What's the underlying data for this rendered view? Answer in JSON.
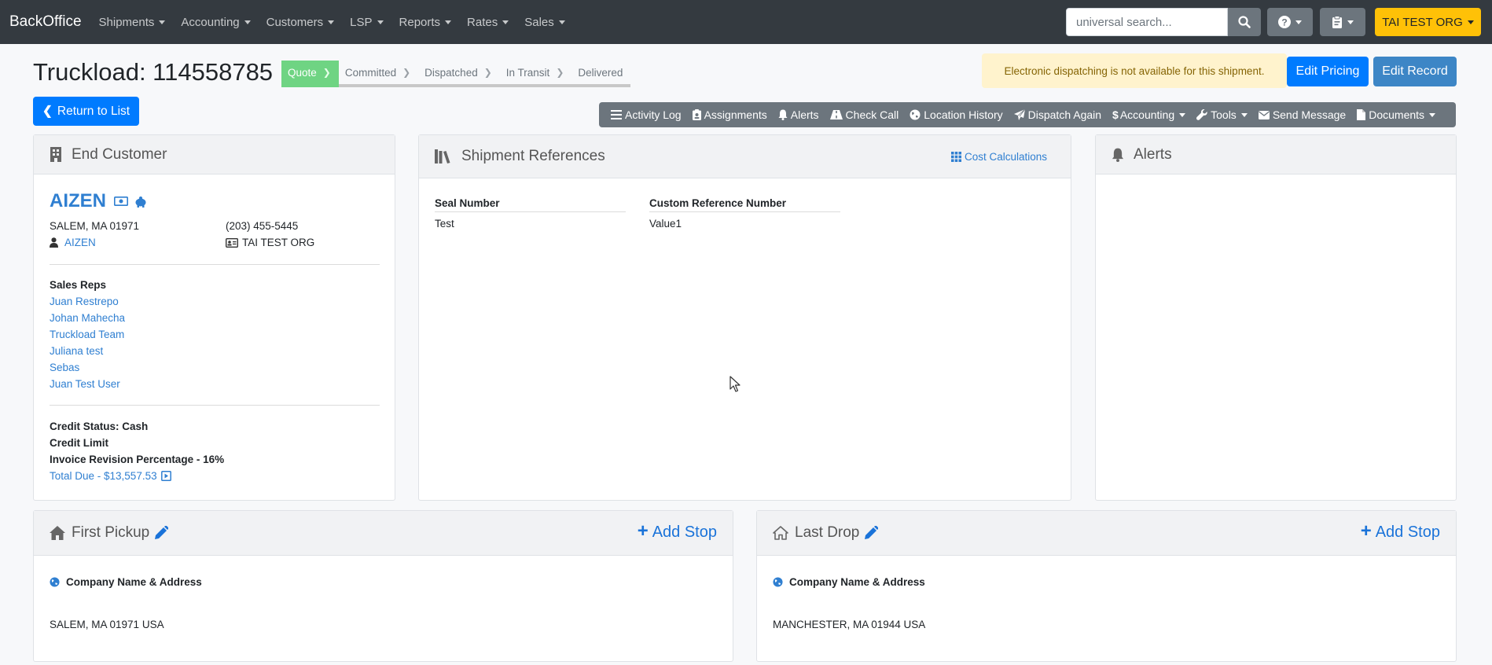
{
  "nav": {
    "brand": "BackOffice",
    "menus": [
      "Shipments",
      "Accounting",
      "Customers",
      "LSP",
      "Reports",
      "Rates",
      "Sales"
    ],
    "search_placeholder": "universal search...",
    "org_button": "TAI TEST ORG"
  },
  "header": {
    "title": "Truckload: 114558785",
    "steps": [
      "Quote",
      "Committed",
      "Dispatched",
      "In Transit",
      "Delivered"
    ],
    "active_step": "Quote",
    "alert": "Electronic dispatching is not available for this shipment.",
    "edit_pricing": "Edit Pricing",
    "edit_record": "Edit Record",
    "return_to_list": "Return to List"
  },
  "toolbar": {
    "items": [
      "Activity Log",
      "Assignments",
      "Alerts",
      "Check Call",
      "Location History",
      "Dispatch Again",
      "Accounting",
      "Tools",
      "Send Message",
      "Documents"
    ]
  },
  "end_customer": {
    "header": "End Customer",
    "name": "AIZEN",
    "city": "SALEM, MA 01971",
    "phone": "(203) 455-5445",
    "contact": "AIZEN",
    "org": "TAI TEST ORG",
    "sales_reps_label": "Sales Reps",
    "sales_reps": [
      "Juan Restrepo",
      "Johan Mahecha",
      "Truckload Team",
      "Juliana test",
      "Sebas",
      "Juan Test User"
    ],
    "credit_status": "Credit Status: Cash",
    "credit_limit": "Credit Limit",
    "invoice_revision": "Invoice Revision Percentage - 16%",
    "total_due": "Total Due - $13,557.53"
  },
  "shipment_references": {
    "header": "Shipment References",
    "cost_calculations": "Cost Calculations",
    "columns": [
      "Seal Number",
      "Custom Reference Number"
    ],
    "values": [
      "Test",
      "Value1"
    ]
  },
  "alerts_panel": {
    "header": "Alerts"
  },
  "first_pickup": {
    "header": "First Pickup",
    "add_stop": "Add Stop",
    "label": "Company Name & Address",
    "address": "SALEM, MA 01971 USA"
  },
  "last_drop": {
    "header": "Last Drop",
    "add_stop": "Add Stop",
    "label": "Company Name & Address",
    "address": "MANCHESTER, MA 01944 USA"
  },
  "colors": {
    "navbar": "#343a40",
    "primary": "#007bff",
    "warning": "#ffc107",
    "step_active": "#6fd483",
    "link": "#2f7fd1"
  }
}
